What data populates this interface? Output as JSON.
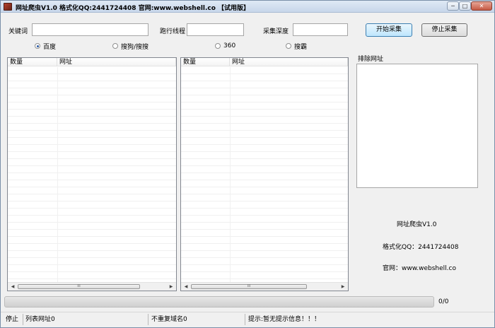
{
  "window": {
    "title": "网址爬虫V1.0 格式化QQ:2441724408 官网:www.webshell.co 【试用版】"
  },
  "titlebar_buttons": {
    "minimize": "─",
    "maximize": "□",
    "close": "✕"
  },
  "form": {
    "keyword_label": "关键词",
    "keyword_value": "",
    "threads_label": "跑行线程",
    "threads_value": "",
    "depth_label": "采集深度",
    "depth_value": ""
  },
  "buttons": {
    "start": "开始采集",
    "stop": "停止采集"
  },
  "engines": [
    {
      "label": "百度",
      "checked": true
    },
    {
      "label": "搜狗/搜搜",
      "checked": false
    },
    {
      "label": "360",
      "checked": false
    },
    {
      "label": "搜霸",
      "checked": false
    }
  ],
  "list_left": {
    "columns": [
      "数量",
      "网址"
    ]
  },
  "list_right": {
    "columns": [
      "数量",
      "网址"
    ]
  },
  "scroll": {
    "left_arrow": "◀",
    "right_arrow": "▶",
    "thumb_grip": "III"
  },
  "exclude": {
    "title": "排除网址",
    "value": ""
  },
  "info": {
    "app": "网址爬虫V1.0",
    "qq": "格式化QQ：2441724408",
    "site": "官网：www.webshell.co"
  },
  "progress": {
    "text": "0/0",
    "value": 0
  },
  "status": {
    "state": "停止",
    "list_count": "列表网址0",
    "unique_domains": "不重复域名0",
    "hint": "提示:暂无提示信息！！！"
  }
}
